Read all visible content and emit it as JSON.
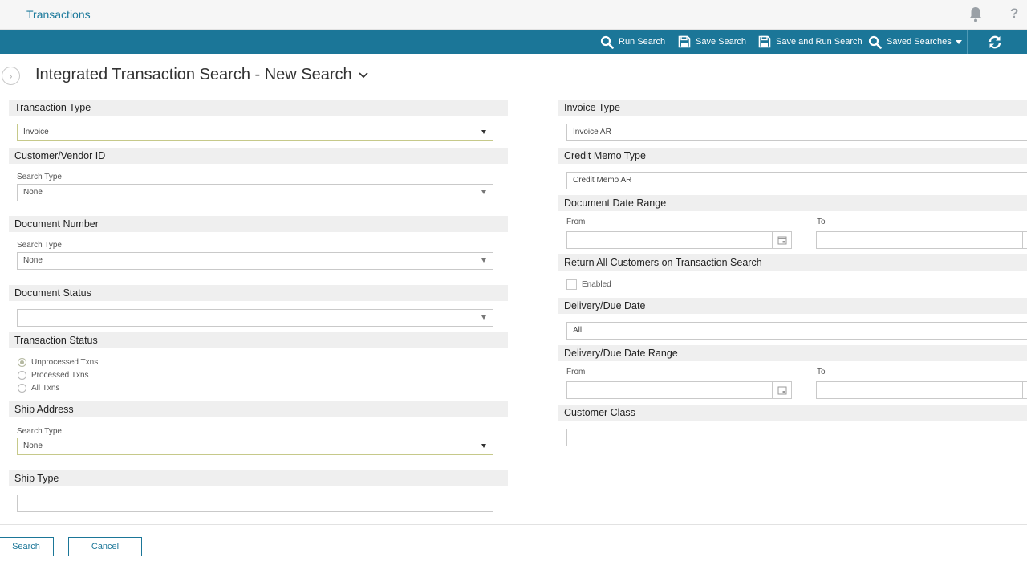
{
  "app": {
    "title": "Transactions"
  },
  "toolbar": {
    "run_search": "Run Search",
    "save_search": "Save Search",
    "save_and_run": "Save and Run Search",
    "saved_searches": "Saved Searches"
  },
  "page": {
    "title": "Integrated Transaction Search - New Search"
  },
  "left": {
    "transaction_type": {
      "heading": "Transaction Type",
      "value": "Invoice"
    },
    "customer_vendor_id": {
      "heading": "Customer/Vendor ID",
      "sub_label": "Search Type",
      "value": "None"
    },
    "document_number": {
      "heading": "Document Number",
      "sub_label": "Search Type",
      "value": "None"
    },
    "document_status": {
      "heading": "Document Status",
      "value": ""
    },
    "transaction_status": {
      "heading": "Transaction Status",
      "options": [
        "Unprocessed Txns",
        "Processed Txns",
        "All Txns"
      ],
      "selected": "Unprocessed Txns"
    },
    "ship_address": {
      "heading": "Ship Address",
      "sub_label": "Search Type",
      "value": "None"
    },
    "ship_type": {
      "heading": "Ship Type",
      "value": ""
    }
  },
  "right": {
    "invoice_type": {
      "heading": "Invoice Type",
      "value": "Invoice AR"
    },
    "credit_memo_type": {
      "heading": "Credit Memo Type",
      "value": "Credit Memo AR"
    },
    "document_date_range": {
      "heading": "Document Date Range",
      "from_label": "From",
      "to_label": "To"
    },
    "return_all_customers": {
      "heading": "Return All Customers on Transaction Search",
      "checkbox_label": "Enabled",
      "checked": false
    },
    "delivery_due_date": {
      "heading": "Delivery/Due Date",
      "value": "All"
    },
    "delivery_due_date_range": {
      "heading": "Delivery/Due Date Range",
      "from_label": "From",
      "to_label": "To"
    },
    "customer_class": {
      "heading": "Customer Class",
      "value": ""
    }
  },
  "footer": {
    "search_label": "Search",
    "cancel_label": "Cancel"
  },
  "colors": {
    "toolbar": "#1b7698",
    "accent": "#1d7a9c",
    "section_bg": "#efefef"
  }
}
